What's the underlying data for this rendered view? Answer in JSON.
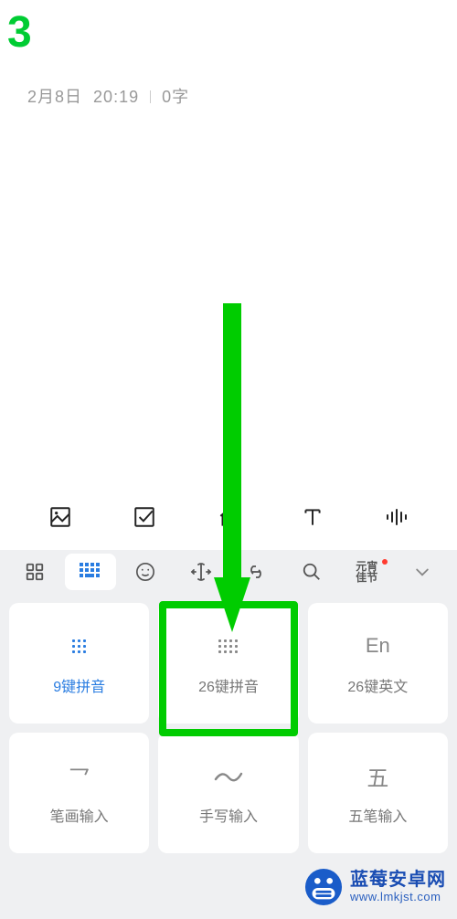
{
  "step_number": "3",
  "meta": {
    "date": "2月8日",
    "time": "20:19",
    "word_count": "0字"
  },
  "editor_toolbar": {
    "items": [
      "image",
      "checkbox",
      "home",
      "text",
      "voice"
    ]
  },
  "ime_toolbar": {
    "items": [
      {
        "name": "apps-icon",
        "active": false
      },
      {
        "name": "keyboard-icon",
        "active": true
      },
      {
        "name": "emoji-icon",
        "active": false
      },
      {
        "name": "cursor-icon",
        "active": false
      },
      {
        "name": "link-icon",
        "active": false
      },
      {
        "name": "search-icon",
        "active": false
      },
      {
        "name": "festival-icon",
        "active": false,
        "label_line1": "元宵",
        "label_line2": "佳节",
        "badge": true
      },
      {
        "name": "chevron-down-icon",
        "active": false
      }
    ]
  },
  "layout_options": [
    {
      "id": "9key",
      "label": "9键拼音",
      "icon": "nine-dots",
      "highlighted": true,
      "boxed": false
    },
    {
      "id": "26key",
      "label": "26键拼音",
      "icon": "twelve-dots",
      "highlighted": false,
      "boxed": true
    },
    {
      "id": "26en",
      "label": "26键英文",
      "icon_text": "En",
      "highlighted": false,
      "boxed": false
    },
    {
      "id": "bihua",
      "label": "笔画输入",
      "icon_text": "乛",
      "highlighted": false,
      "boxed": false
    },
    {
      "id": "hand",
      "label": "手写输入",
      "icon": "wave",
      "highlighted": false,
      "boxed": false
    },
    {
      "id": "wubi",
      "label": "五笔输入",
      "icon_text": "五",
      "highlighted": false,
      "boxed": false
    }
  ],
  "watermark": {
    "title": "蓝莓安卓网",
    "url": "www.lmkjst.com"
  }
}
